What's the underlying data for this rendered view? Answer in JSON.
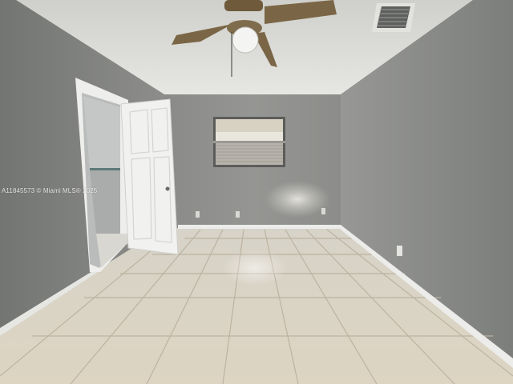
{
  "photo": {
    "subject": "empty bedroom with tile floor, ceiling fan, window and open door",
    "watermark": "A11845573 © Miami MLS® 2025"
  },
  "colors": {
    "ceiling": "#d9d9d6",
    "back_wall": "#8c8d8a",
    "left_wall": "#7e807d",
    "right_wall": "#858785",
    "floor_tile": "#d8d0bf",
    "grout": "#b5ad9c",
    "baseboard": "#ececea",
    "door": "#efefef"
  }
}
